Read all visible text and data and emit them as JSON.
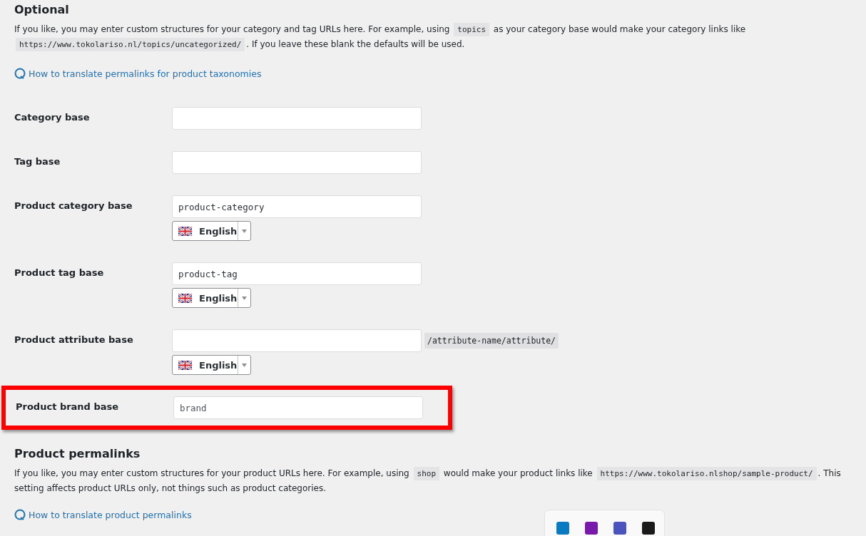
{
  "optional": {
    "heading": "Optional",
    "description": [
      {
        "kind": "text",
        "text": "If you like, you may enter custom structures for your category and tag URLs here. For example, using "
      },
      {
        "kind": "code",
        "text": "topics"
      },
      {
        "kind": "text",
        "text": " as your category base would make your category links like "
      },
      {
        "kind": "code",
        "text": "https://www.tokolariso.nl/topics/uncategorized/"
      },
      {
        "kind": "text",
        "text": ". If you leave these blank the defaults will be used."
      }
    ],
    "help_link": "How to translate permalinks for product taxonomies",
    "fields": [
      {
        "label": "Category base",
        "highlighted": false
      },
      {
        "label": "Tag base",
        "highlighted": false
      },
      {
        "label": "Product category base",
        "value": "product-category",
        "language": "English",
        "highlighted": false
      },
      {
        "label": "Product tag base",
        "value": "product-tag",
        "language": "English",
        "highlighted": false
      },
      {
        "label": "Product attribute base",
        "suffix": "/attribute-name/attribute/",
        "language": "English",
        "highlighted": false
      },
      {
        "label": "Product brand base",
        "placeholder": "brand",
        "highlighted": true
      }
    ]
  },
  "product_permalinks": {
    "heading": "Product permalinks",
    "description": [
      {
        "kind": "text",
        "text": "If you like, you may enter custom structures for your product URLs here. For example, using "
      },
      {
        "kind": "code",
        "text": "shop"
      },
      {
        "kind": "text",
        "text": " would make your product links like "
      },
      {
        "kind": "code",
        "text": "https://www.tokolariso.nlshop/sample-product/"
      },
      {
        "kind": "text",
        "text": ". This setting affects product URLs only, not things such as product categories."
      }
    ],
    "help_link": "How to translate product permalinks"
  },
  "tray_apps": [
    {
      "color": "#0a7bc0"
    },
    {
      "color": "#7719aa"
    },
    {
      "color": "#4b53bc"
    },
    {
      "color": "#1a1a1a"
    }
  ]
}
